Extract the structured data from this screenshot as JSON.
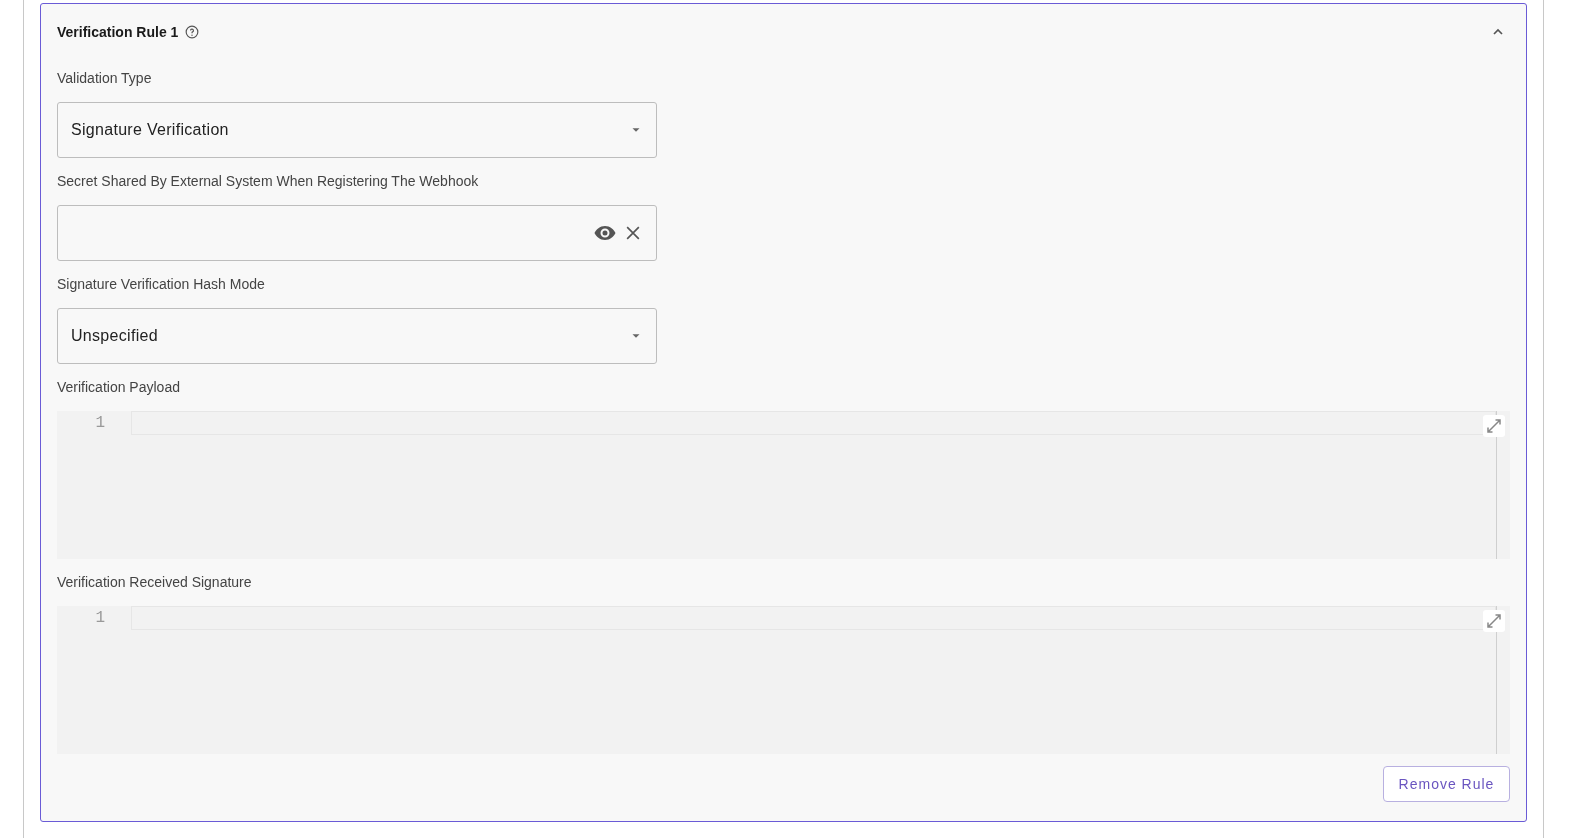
{
  "rule": {
    "title": "Verification Rule 1",
    "expanded": true,
    "fields": [
      {
        "kind": "select",
        "label": "Validation Type",
        "value": "Signature Verification"
      },
      {
        "kind": "secret",
        "label": "Secret Shared By External System When Registering The Webhook"
      },
      {
        "kind": "select",
        "label": "Signature Verification Hash Mode",
        "value": "Unspecified"
      },
      {
        "kind": "code",
        "label": "Verification Payload",
        "line_numbers": [
          "1"
        ]
      },
      {
        "kind": "code",
        "label": "Verification Received Signature",
        "line_numbers": [
          "1"
        ]
      }
    ],
    "remove_button": "Remove Rule"
  }
}
